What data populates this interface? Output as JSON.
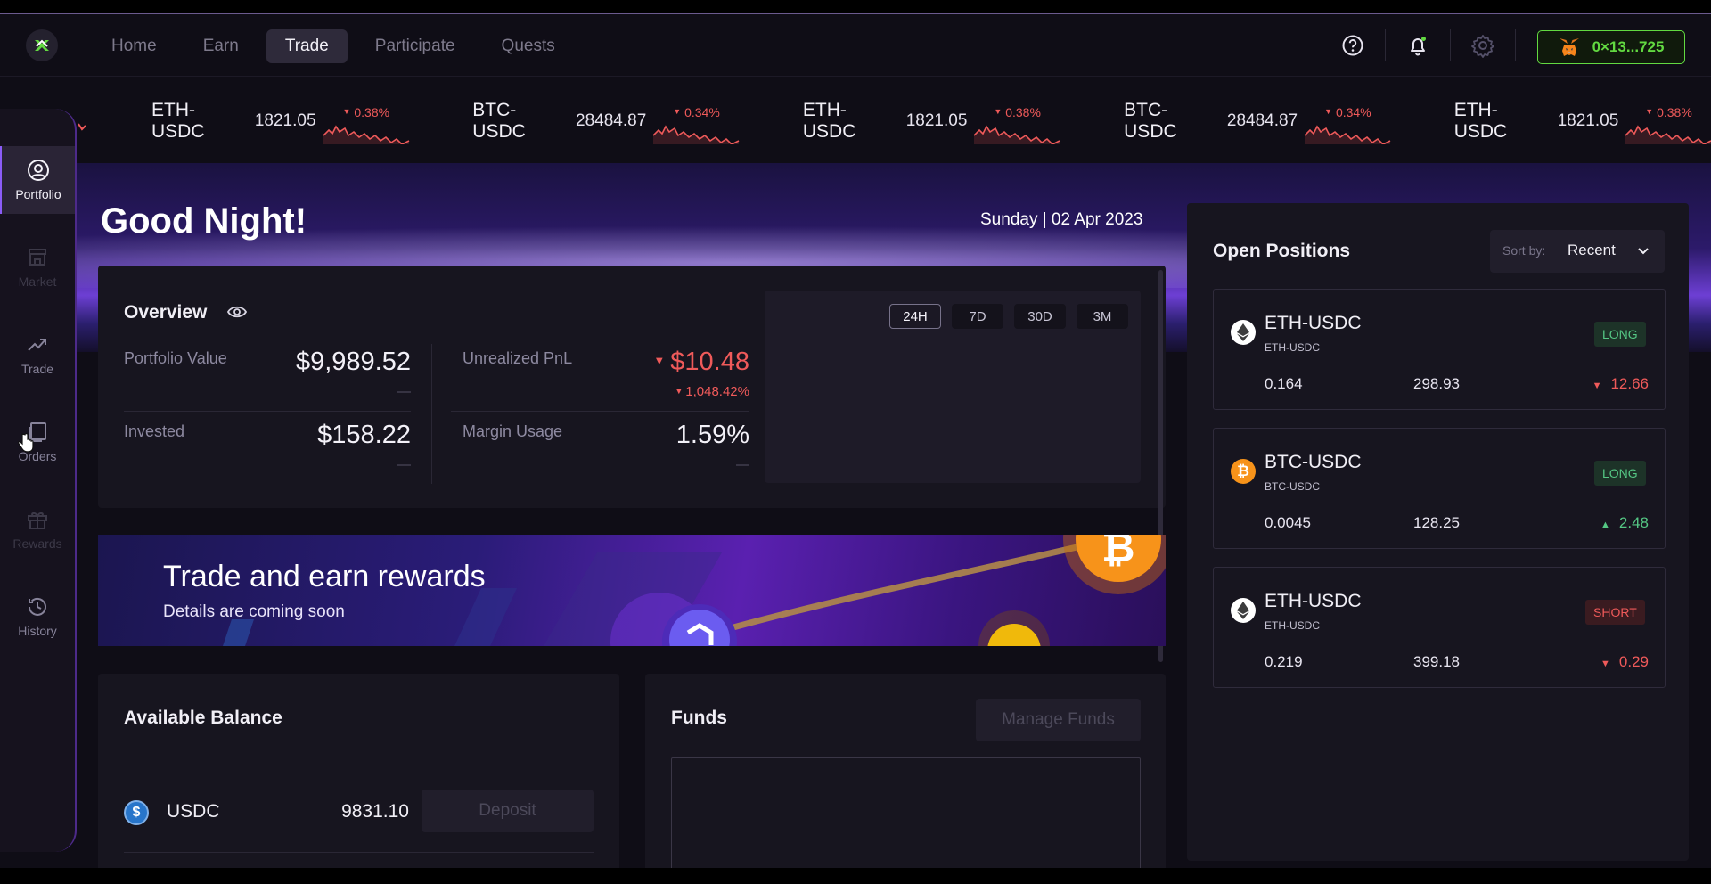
{
  "nav": {
    "tabs": [
      {
        "label": "Home"
      },
      {
        "label": "Earn"
      },
      {
        "label": "Trade"
      },
      {
        "label": "Participate"
      },
      {
        "label": "Quests"
      }
    ],
    "wallet_label": "0×13...725"
  },
  "ticker": [
    {
      "pair": "ETH-USDC",
      "price": "1821.05",
      "change": "0.38%",
      "direction": "down"
    },
    {
      "pair": "BTC-USDC",
      "price": "28484.87",
      "change": "0.34%",
      "direction": "down"
    },
    {
      "pair": "ETH-USDC",
      "price": "1821.05",
      "change": "0.38%",
      "direction": "down"
    },
    {
      "pair": "BTC-USDC",
      "price": "28484.87",
      "change": "0.34%",
      "direction": "down"
    },
    {
      "pair": "ETH-USDC",
      "price": "1821.05",
      "change": "0.38%",
      "direction": "down"
    }
  ],
  "sidebar": {
    "items": [
      {
        "label": "Portfolio",
        "icon": "user-circle-icon",
        "state": "active"
      },
      {
        "label": "Market",
        "icon": "market-stall-icon",
        "state": "disabled"
      },
      {
        "label": "Trade",
        "icon": "trend-up-icon",
        "state": "normal"
      },
      {
        "label": "Orders",
        "icon": "orders-icon",
        "state": "normal"
      },
      {
        "label": "Rewards",
        "icon": "gift-icon",
        "state": "disabled"
      },
      {
        "label": "History",
        "icon": "history-icon",
        "state": "normal"
      }
    ]
  },
  "hero": {
    "greeting": "Good Night!",
    "date": "Sunday | 02 Apr 2023"
  },
  "overview": {
    "title": "Overview",
    "portfolio_value_label": "Portfolio Value",
    "portfolio_value": "$9,989.52",
    "portfolio_value_sub": "—",
    "unrealized_pnl_label": "Unrealized PnL",
    "unrealized_pnl": "$10.48",
    "unrealized_pnl_sub": "1,048.42%",
    "invested_label": "Invested",
    "invested": "$158.22",
    "invested_sub": "—",
    "margin_usage_label": "Margin Usage",
    "margin_usage": "1.59%",
    "margin_usage_sub": "—",
    "timeframes": [
      "24H",
      "7D",
      "30D",
      "3M"
    ],
    "active_timeframe": "24H"
  },
  "banner": {
    "title": "Trade and earn rewards",
    "subtitle": "Details are coming soon"
  },
  "balance": {
    "title": "Available Balance",
    "asset": "USDC",
    "amount": "9831.10",
    "deposit_label": "Deposit"
  },
  "funds": {
    "title": "Funds",
    "manage_label": "Manage Funds"
  },
  "positions": {
    "title": "Open Positions",
    "sort_label": "Sort by:",
    "sort_value": "Recent",
    "items": [
      {
        "pair": "ETH-USDC",
        "sub": "ETH-USDC",
        "side": "LONG",
        "size": "0.164",
        "entry": "298.93",
        "pnl": "12.66",
        "pnl_direction": "down",
        "coin": "eth"
      },
      {
        "pair": "BTC-USDC",
        "sub": "BTC-USDC",
        "side": "LONG",
        "size": "0.0045",
        "entry": "128.25",
        "pnl": "2.48",
        "pnl_direction": "up",
        "coin": "btc"
      },
      {
        "pair": "ETH-USDC",
        "sub": "ETH-USDC",
        "side": "SHORT",
        "size": "0.219",
        "entry": "399.18",
        "pnl": "0.29",
        "pnl_direction": "down",
        "coin": "eth"
      }
    ]
  },
  "colors": {
    "accent_green": "#62d941",
    "loss_red": "#ef5a5a",
    "gain_green": "#55c784",
    "sidebar_accent": "#8b5cf6"
  }
}
